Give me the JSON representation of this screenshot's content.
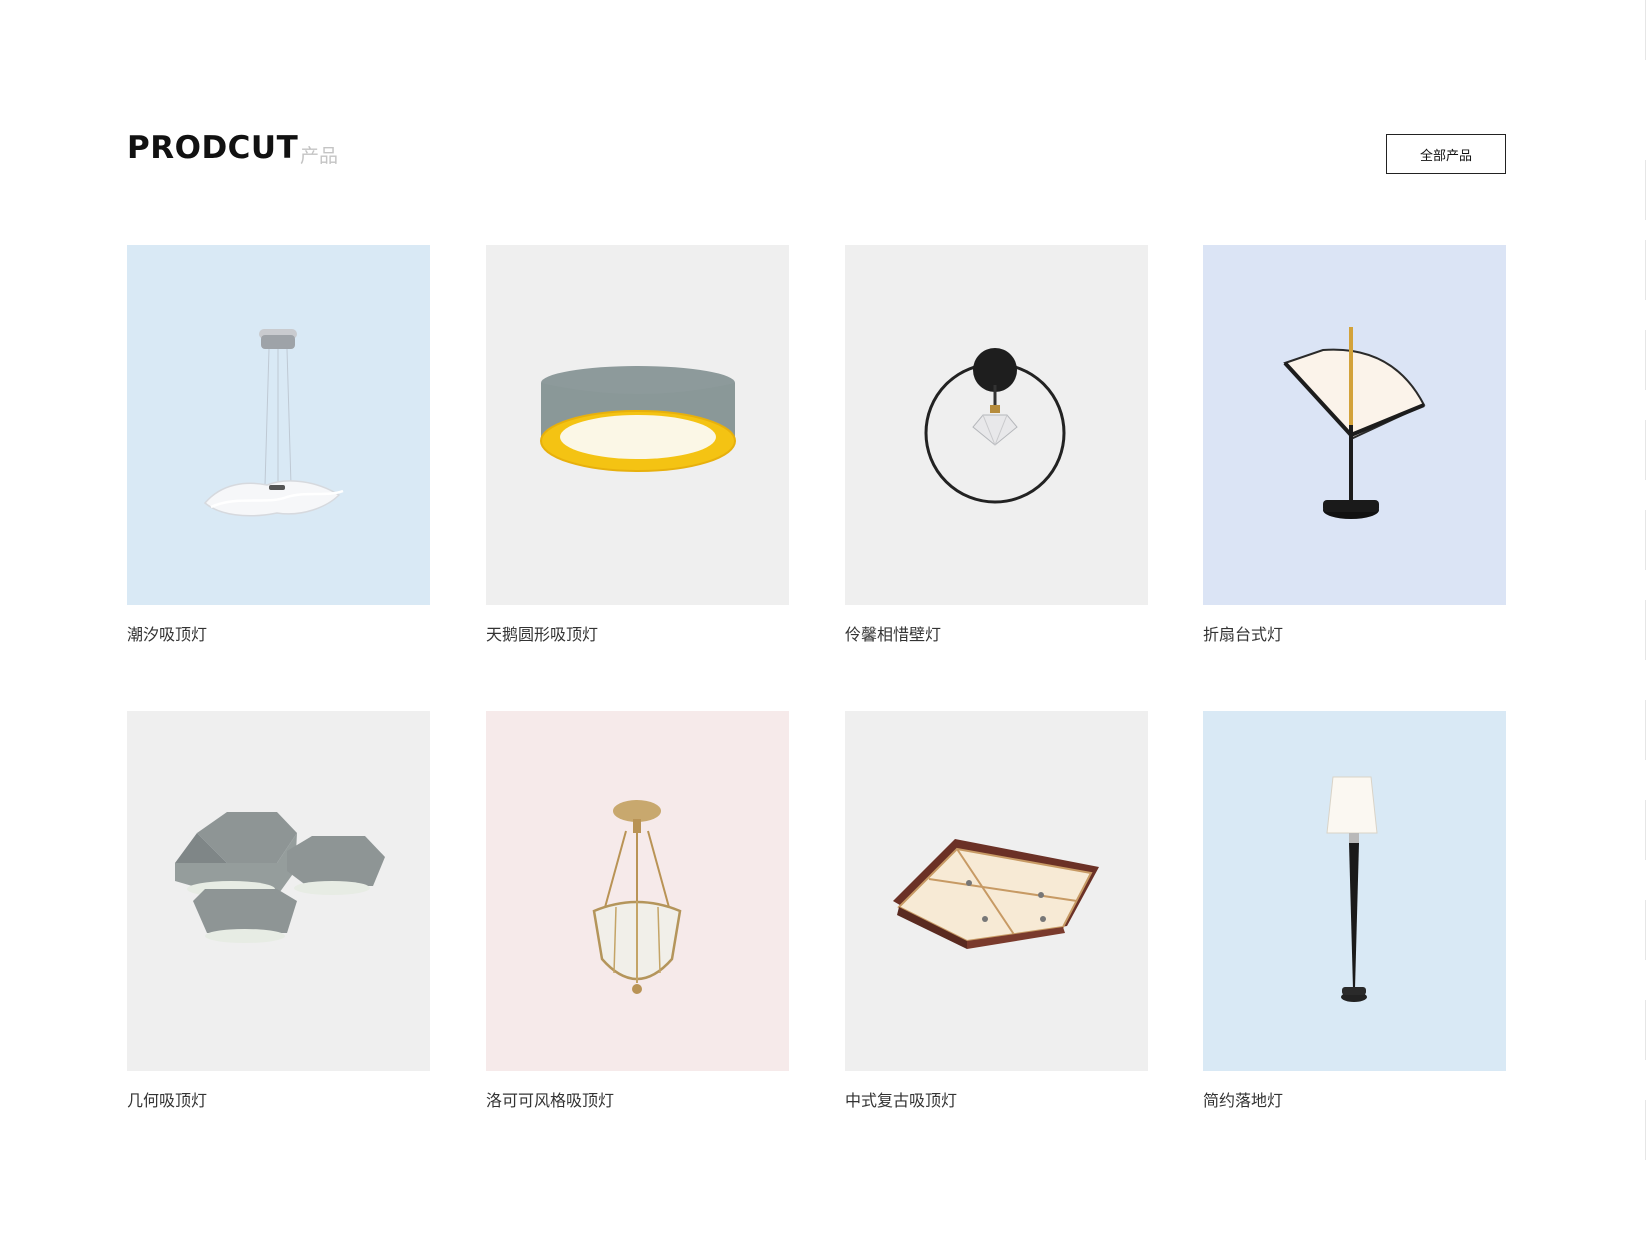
{
  "header": {
    "title_en": "PRODCUT",
    "title_cn": "产品",
    "all_products_label": "全部产品"
  },
  "products": [
    {
      "name": "潮汐吸顶灯",
      "bg": "#d9e9f5",
      "icon": "pendant-wave-lamp-icon"
    },
    {
      "name": "天鹅圆形吸顶灯",
      "bg": "#efefef",
      "icon": "round-ceiling-lamp-icon"
    },
    {
      "name": "伶馨相惜壁灯",
      "bg": "#efefef",
      "icon": "ring-wall-lamp-icon"
    },
    {
      "name": "折扇台式灯",
      "bg": "#dbe4f5",
      "icon": "fan-table-lamp-icon"
    },
    {
      "name": "几何吸顶灯",
      "bg": "#efefef",
      "icon": "hexagon-ceiling-lamp-icon"
    },
    {
      "name": "洛可可风格吸顶灯",
      "bg": "#f6eaea",
      "icon": "rococo-pendant-lamp-icon"
    },
    {
      "name": "中式复古吸顶灯",
      "bg": "#efefef",
      "icon": "chinese-square-ceiling-lamp-icon"
    },
    {
      "name": "简约落地灯",
      "bg": "#d9e9f5",
      "icon": "floor-lamp-icon"
    }
  ],
  "colors": {
    "title": "#111111",
    "subtitle": "#c4c4c4",
    "label": "#333333",
    "button_border": "#222222"
  }
}
